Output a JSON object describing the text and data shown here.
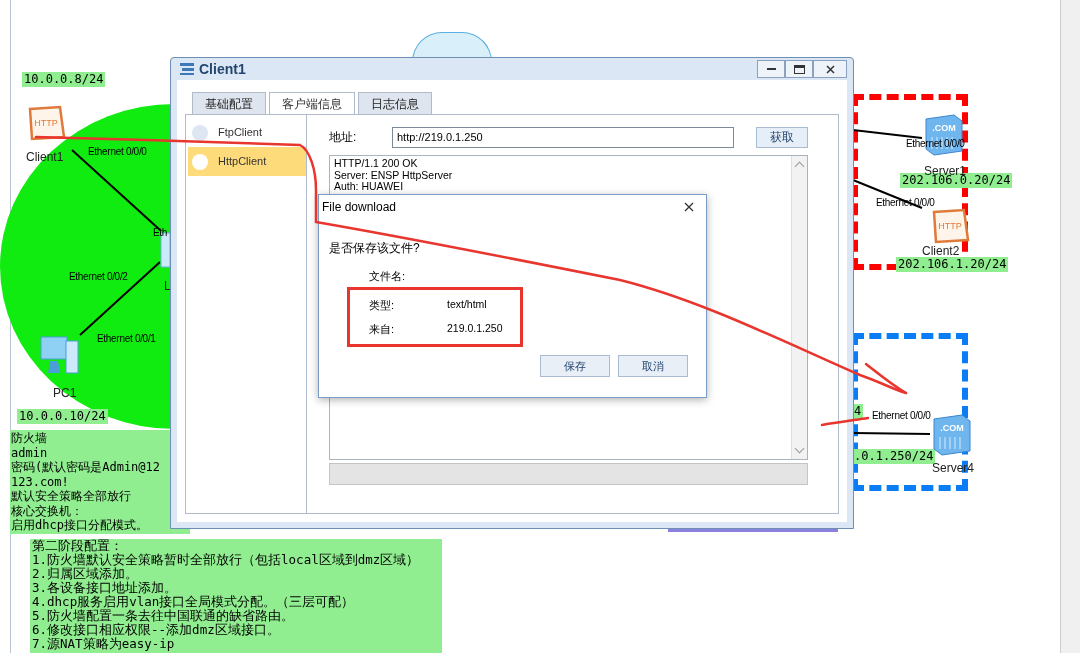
{
  "canvas": {
    "ip_labels": [
      "10.0.0.8/24",
      "10.0.0.10/24",
      "202.106.0.20/24",
      "202.106.1.20/24",
      "4",
      ".0.1.250/24"
    ],
    "nodes": [
      {
        "kind": "client",
        "label": "Client1",
        "badge": "HTTP"
      },
      {
        "kind": "pc",
        "label": "PC1"
      },
      {
        "kind": "switch",
        "label": "L"
      },
      {
        "kind": "server",
        "label": "Server1",
        "badge": ".COM"
      },
      {
        "kind": "client",
        "label": "Client2",
        "badge": "HTTP"
      },
      {
        "kind": "server",
        "label": "Server4",
        "badge": ".COM"
      }
    ],
    "port_labels": [
      "Ethernet 0/0/0",
      "Eth",
      "Ethernet 0/0/2",
      "Ethernet 0/0/1",
      "Ethernet 0/0/0",
      "Ethernet 0/0/0",
      "Ethernet 0/0/0"
    ],
    "notes": [
      {
        "lines": [
          "防火墙",
          "admin",
          "密码(默认密码是Admin@12",
          "123.com!",
          "默认安全策略全部放行",
          "核心交换机：",
          "启用dhcp接口分配模式。"
        ]
      },
      {
        "lines": [
          "第二阶段配置：",
          "1.防火墙默认安全策略暂时全部放行（包括local区域到dmz区域）",
          "2.归属区域添加。",
          "3.各设备接口地址添加。",
          "4.dhcp服务启用vlan接口全局模式分配。（三层可配）",
          "5.防火墙配置一条去往中国联通的缺省路由。",
          "6.修改接口相应权限--添加dmz区域接口。",
          "7.源NAT策略为easy-ip"
        ]
      }
    ]
  },
  "window": {
    "title": "Client1",
    "tabs": [
      {
        "label": "基础配置",
        "selected": false
      },
      {
        "label": "客户端信息",
        "selected": true
      },
      {
        "label": "日志信息",
        "selected": false
      }
    ],
    "sidebar": [
      {
        "label": "FtpClient",
        "selected": false
      },
      {
        "label": "HttpClient",
        "selected": true
      }
    ],
    "address_label": "地址:",
    "address": "http://219.0.1.250",
    "fetch_button": "获取",
    "response_lines": [
      "HTTP/1.1 200 OK",
      "Server: ENSP HttpServer",
      "Auth: HUAWEI"
    ]
  },
  "dialog": {
    "title": "File download",
    "question": "是否保存该文件?",
    "fields": [
      {
        "label": "文件名:",
        "highlighted": false
      },
      {
        "label": "类型:",
        "value": "text/html",
        "highlighted": true
      },
      {
        "label": "来自:",
        "value": "219.0.1.250",
        "highlighted": true
      }
    ],
    "buttons": [
      "保存",
      "取消"
    ]
  }
}
